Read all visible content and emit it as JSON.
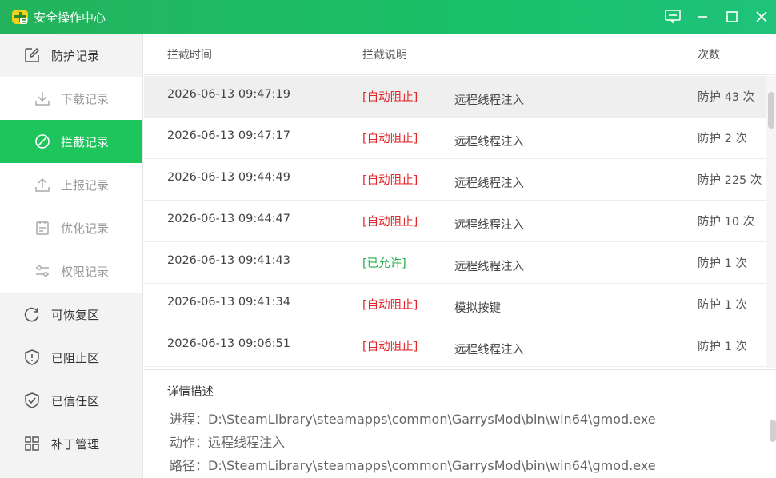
{
  "window": {
    "title": "安全操作中心"
  },
  "sidebar": {
    "top_item": {
      "label": "防护记录",
      "icon": "edit-icon"
    },
    "sub_items": [
      {
        "label": "下载记录",
        "icon": "download-icon"
      },
      {
        "label": "拦截记录",
        "icon": "block-icon",
        "active": true
      },
      {
        "label": "上报记录",
        "icon": "upload-icon"
      },
      {
        "label": "优化记录",
        "icon": "calendar-icon"
      },
      {
        "label": "权限记录",
        "icon": "sliders-icon"
      }
    ],
    "bottom_items": [
      {
        "label": "可恢复区",
        "icon": "restore-icon"
      },
      {
        "label": "已阻止区",
        "icon": "shield-alert-icon"
      },
      {
        "label": "已信任区",
        "icon": "shield-check-icon"
      },
      {
        "label": "补丁管理",
        "icon": "grid-icon"
      }
    ]
  },
  "table": {
    "headers": {
      "time": "拦截时间",
      "desc": "拦截说明",
      "count": "次数"
    },
    "rows": [
      {
        "time": "2026-06-13 09:47:19",
        "status": "[自动阻止]",
        "action": "远程线程注入",
        "count": "防护 43 次"
      },
      {
        "time": "2026-06-13 09:47:17",
        "status": "[自动阻止]",
        "action": "远程线程注入",
        "count": "防护 2 次"
      },
      {
        "time": "2026-06-13 09:44:49",
        "status": "[自动阻止]",
        "action": "远程线程注入",
        "count": "防护 225 次"
      },
      {
        "time": "2026-06-13 09:44:47",
        "status": "[自动阻止]",
        "action": "远程线程注入",
        "count": "防护 10 次"
      },
      {
        "time": "2026-06-13 09:41:43",
        "status": "[已允许]",
        "action": "远程线程注入",
        "count": "防护 1 次"
      },
      {
        "time": "2026-06-13 09:41:34",
        "status": "[自动阻止]",
        "action": "模拟按键",
        "count": "防护 1 次"
      },
      {
        "time": "2026-06-13 09:06:51",
        "status": "[自动阻止]",
        "action": "远程线程注入",
        "count": "防护 1 次"
      }
    ]
  },
  "detail": {
    "title": "详情描述",
    "process": "进程：D:\\SteamLibrary\\steamapps\\common\\GarrysMod\\bin\\win64\\gmod.exe",
    "action": "动作：远程线程注入",
    "path": "路径：D:\\SteamLibrary\\steamapps\\common\\GarrysMod\\bin\\win64\\gmod.exe"
  },
  "colors": {
    "brand_green": "#1ec55c",
    "block_red": "#e0272b",
    "allow_green": "#22b04a"
  }
}
